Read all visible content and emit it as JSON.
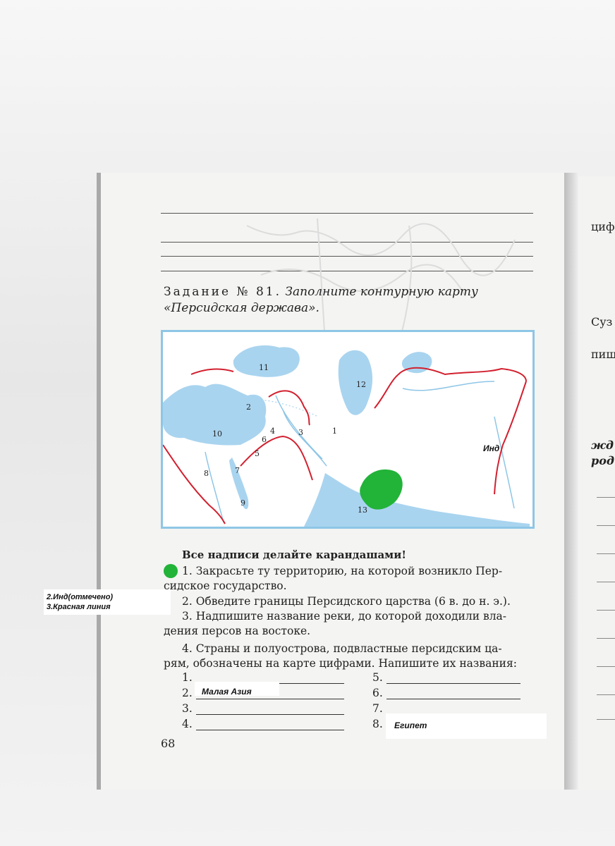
{
  "right_page_fragments": [
    "цифр",
    "Суз",
    "пищ",
    "жд",
    "род"
  ],
  "task": {
    "label": "Задание № 81.",
    "description": "Заполните контурную карту «Персидская держава»."
  },
  "map": {
    "numbers": [
      "1",
      "2",
      "3",
      "4",
      "5",
      "6",
      "7",
      "8",
      "9",
      "10",
      "11",
      "12",
      "13"
    ],
    "annotation_river": "Инд"
  },
  "instructions": {
    "warning": "Все надписи делайте карандашами!",
    "item1_a": "1. Закрасьте ту территорию, на которой возникло Пер-",
    "item1_b": "сидское государство.",
    "item2": "2. Обведите границы Персидского царства (6 в. до н. э.).",
    "item3_a": "3. Надпишите название реки, до которой доходили вла-",
    "item3_b": "дения персов на востоке.",
    "item4_a": "4. Страны и полуострова, подвластные персидским ца-",
    "item4_b": "рям, обозначены на карте цифрами. Напишите их названия:"
  },
  "side_note": {
    "line1": "2.Инд(отмечено)",
    "line2": "3.Красная линия"
  },
  "answers": {
    "left": [
      {
        "num": "1.",
        "value": ""
      },
      {
        "num": "2.",
        "value": "Малая Азия"
      },
      {
        "num": "3.",
        "value": ""
      },
      {
        "num": "4.",
        "value": ""
      }
    ],
    "right": [
      {
        "num": "5.",
        "value": ""
      },
      {
        "num": "6.",
        "value": ""
      },
      {
        "num": "7.",
        "value": ""
      },
      {
        "num": "8.",
        "value": "Египет"
      }
    ]
  },
  "page_number": "68",
  "colors": {
    "water": "#a9d4ef",
    "border_line": "#d2202f",
    "highlight": "#22b339",
    "frame": "#8ec6e6"
  }
}
